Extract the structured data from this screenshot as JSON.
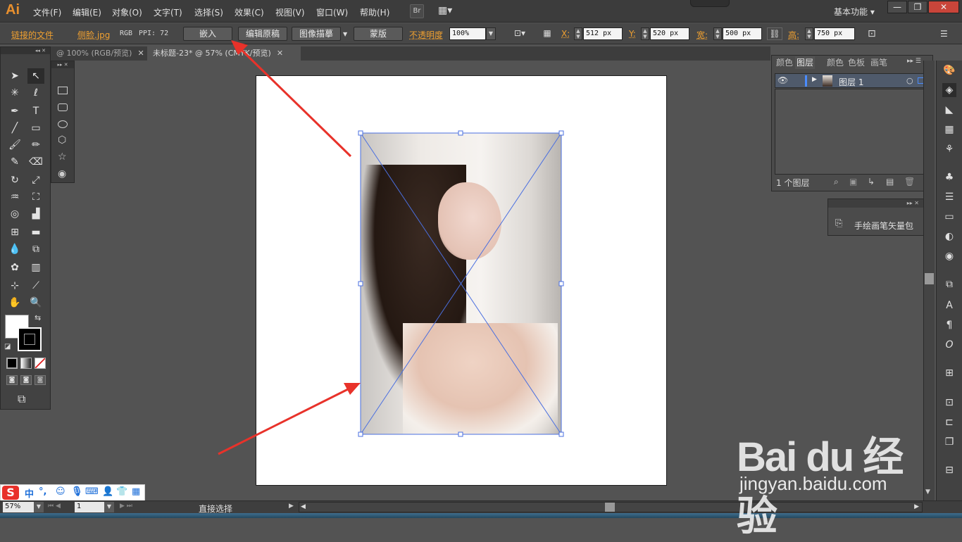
{
  "app": {
    "logo": "Ai",
    "menu": [
      "文件(F)",
      "编辑(E)",
      "对象(O)",
      "文字(T)",
      "选择(S)",
      "效果(C)",
      "视图(V)",
      "窗口(W)",
      "帮助(H)"
    ],
    "bridge_label": "Br",
    "workspace": "基本功能",
    "window_buttons": [
      "—",
      "❐",
      "✕"
    ]
  },
  "control_bar": {
    "linked_file_label": "链接的文件",
    "file_name": "侧脸.jpg",
    "color_mode": "RGB",
    "ppi_label": "PPI: 72",
    "embed_button": "嵌入",
    "edit_original_button": "编辑原稿",
    "image_trace_button": "图像描摹",
    "mask_button": "蒙版",
    "opacity_label": "不透明度",
    "opacity_value": "100%",
    "x_label": "X:",
    "x_value": "512 px",
    "y_label": "Y:",
    "y_value": "520 px",
    "w_label": "宽:",
    "w_value": "500 px",
    "h_label": "高:",
    "h_value": "750 px"
  },
  "tabs": [
    {
      "label": "@ 100% (RGB/预览)",
      "close": "✕",
      "active": false
    },
    {
      "label": "未标题-23* @ 57% (CMYK/预览)",
      "close": "✕",
      "active": true
    }
  ],
  "panels": {
    "layers_tabs": [
      "颜色",
      "图层",
      "颜色",
      "色板",
      "画笔"
    ],
    "layer_name": "图层 1",
    "layer_count": "1 个图层",
    "brush_item": "手绘画笔矢量包"
  },
  "status": {
    "zoom": "57%",
    "page": "1",
    "tool_name": "直接选择"
  },
  "ime": {
    "mode": "中"
  },
  "watermark": {
    "brand": "Bai du 经验",
    "url": "jingyan.baidu.com"
  },
  "colors": {
    "accent_orange": "#f0a030",
    "selection_blue": "#4a6fe0",
    "arrow_red": "#e8322a"
  }
}
